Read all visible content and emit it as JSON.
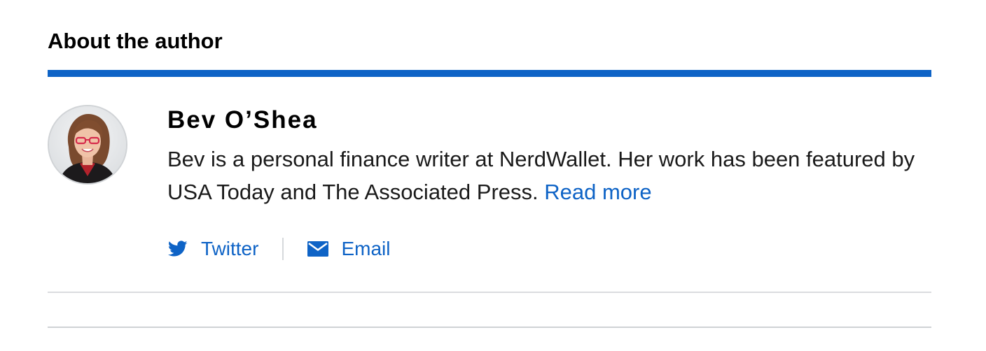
{
  "section": {
    "heading": "About the author"
  },
  "author": {
    "name": "Bev O’Shea",
    "bio": "Bev is a personal finance writer at NerdWallet. Her work has been featured by USA Today and The Associated Press. ",
    "read_more_label": "Read more",
    "avatar_icon": "author-photo"
  },
  "social": [
    {
      "label": "Twitter",
      "icon": "twitter-bird-icon"
    },
    {
      "label": "Email",
      "icon": "envelope-icon"
    }
  ],
  "colors": {
    "accent": "#0e63c6",
    "rule": "#dadcdf",
    "text": "#111111"
  }
}
